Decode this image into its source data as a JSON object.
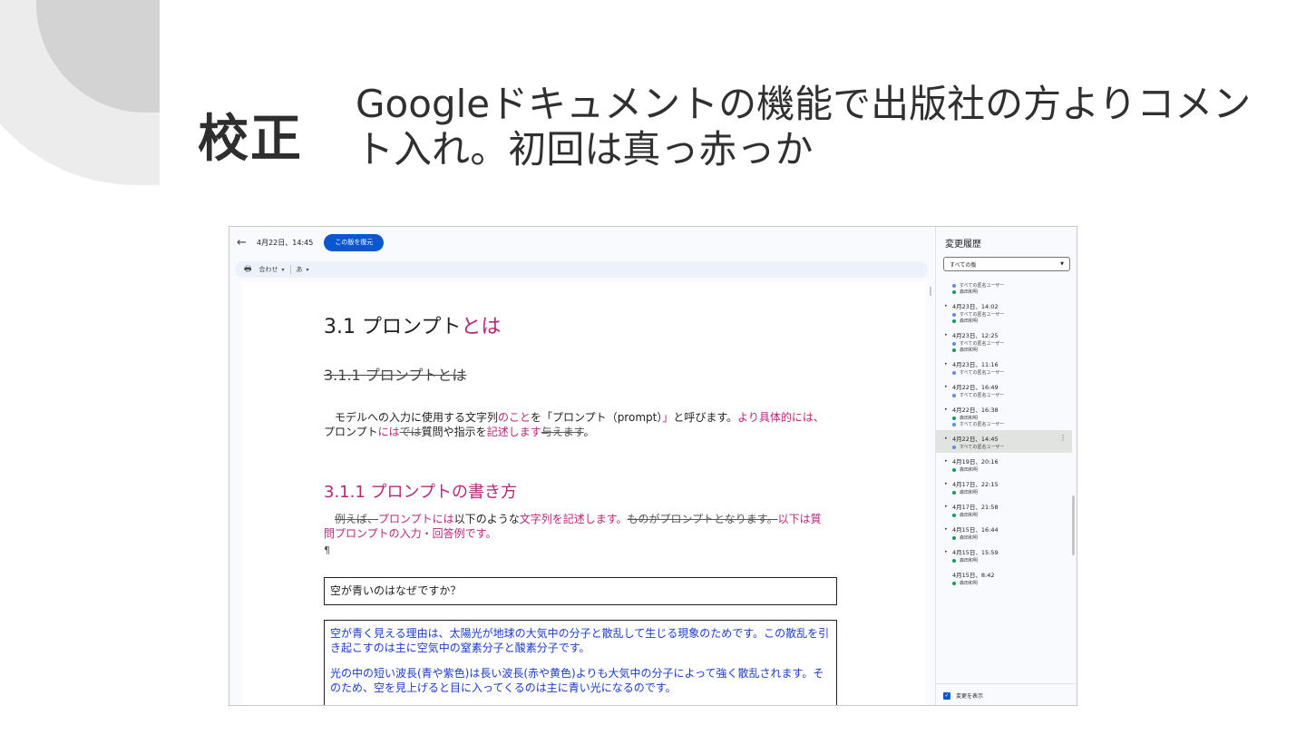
{
  "slide": {
    "title": "校正",
    "subtitle": "Googleドキュメントの機能で出版社の方よりコメント入れ。初回は真っ赤っか"
  },
  "topbar": {
    "back_icon": "arrow-left-icon",
    "version_date": "4月22日、14:45",
    "restore_label": "この版を復元"
  },
  "toolbar": {
    "print_icon": "print-icon",
    "zoom": "合わせ",
    "dropdown_icon": "chevron-down-icon",
    "input_mode": "あ"
  },
  "doc": {
    "h1_text": "3.1 プロンプト",
    "h1_ins": "とは",
    "h2_deleted": "3.1.1 プロンプトとは",
    "para1": {
      "a": "モデルへの入力に使用する文字列",
      "b_ins": "のこと",
      "c": "を「プロンプト（prompt）",
      "d_ins": "」",
      "e": "と呼びます。",
      "f_ins": "より具体的には、",
      "g": "プロンプト",
      "h_ins": "には",
      "i_del": "では",
      "j": "質問や指示を",
      "k_ins": "記述します",
      "l_del": "与えます",
      "m": "。"
    },
    "h2": "3.1.1 プロンプトの書き方",
    "para2": {
      "a_del": "例えば、",
      "b_ins": "プロンプトには",
      "c": "以下のような",
      "d_ins": "文字列を記述します。",
      "e_del": "ものがプロンプトとなります。",
      "f_ins": "以下は質問プロンプトの入力・回答例です。"
    },
    "pilcrow": "¶",
    "question": "空が青いのはなぜですか？",
    "answer_p1": "空が青く見える理由は、太陽光が地球の大気中の分子と散乱して生じる現象のためです。この散乱を引き起こすのは主に空気中の窒素分子と酸素分子です。",
    "answer_p2": "光の中の短い波長(青や紫色)は長い波長(赤や黄色)よりも大気中の分子によって強く散乱されます。そのため、空を見上げると目に入ってくるのは主に青い光になるのです。"
  },
  "panel": {
    "title": "変更履歴",
    "filter": "すべての版",
    "show_changes": "変更を表示",
    "dot_colors": {
      "anon": "#5b8def",
      "user": "#0f9d58"
    },
    "versions": [
      {
        "name": "",
        "users": [
          "すべての匿名ユーザー",
          "森田和明"
        ],
        "colors": [
          "anon",
          "user"
        ],
        "arrow": false
      },
      {
        "name": "4月23日、14:02",
        "users": [
          "すべての匿名ユーザー",
          "森田和明"
        ],
        "colors": [
          "anon",
          "user"
        ],
        "arrow": true
      },
      {
        "name": "4月23日、12:25",
        "users": [
          "すべての匿名ユーザー",
          "森田和明"
        ],
        "colors": [
          "anon",
          "user"
        ],
        "arrow": true
      },
      {
        "name": "4月23日、11:16",
        "users": [
          "すべての匿名ユーザー"
        ],
        "colors": [
          "anon"
        ],
        "arrow": true
      },
      {
        "name": "4月22日、16:49",
        "users": [
          "すべての匿名ユーザー"
        ],
        "colors": [
          "anon"
        ],
        "arrow": true
      },
      {
        "name": "4月22日、16:38",
        "users": [
          "森田和明",
          "すべての匿名ユーザー"
        ],
        "colors": [
          "user",
          "anon"
        ],
        "arrow": true
      },
      {
        "name": "4月22日、14:45",
        "users": [
          "すべての匿名ユーザー"
        ],
        "colors": [
          "anon"
        ],
        "arrow": true,
        "selected": true
      },
      {
        "name": "4月19日、20:16",
        "users": [
          "森田和明"
        ],
        "colors": [
          "user"
        ],
        "arrow": true
      },
      {
        "name": "4月17日、22:15",
        "users": [
          "森田和明"
        ],
        "colors": [
          "user"
        ],
        "arrow": true
      },
      {
        "name": "4月17日、21:58",
        "users": [
          "森田和明"
        ],
        "colors": [
          "user"
        ],
        "arrow": true
      },
      {
        "name": "4月15日、16:44",
        "users": [
          "森田和明"
        ],
        "colors": [
          "user"
        ],
        "arrow": true
      },
      {
        "name": "4月15日、15:59",
        "users": [
          "森田和明"
        ],
        "colors": [
          "user"
        ],
        "arrow": true
      },
      {
        "name": "4月15日、8:42",
        "users": [
          "森田和明"
        ],
        "colors": [
          "user"
        ],
        "arrow": false
      }
    ]
  }
}
